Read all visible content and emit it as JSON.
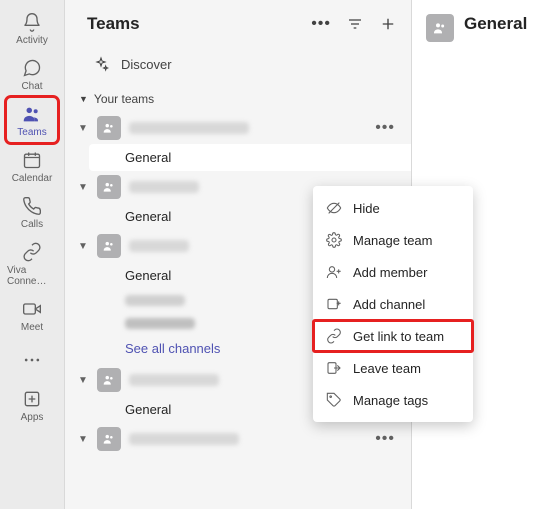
{
  "rail": {
    "items": [
      {
        "label": "Activity",
        "icon": "bell"
      },
      {
        "label": "Chat",
        "icon": "chat"
      },
      {
        "label": "Teams",
        "icon": "people",
        "selected": true
      },
      {
        "label": "Calendar",
        "icon": "calendar"
      },
      {
        "label": "Calls",
        "icon": "phone"
      },
      {
        "label": "Viva Conne…",
        "icon": "link"
      },
      {
        "label": "Meet",
        "icon": "video"
      },
      {
        "label": "",
        "icon": "more",
        "more": true
      },
      {
        "label": "Apps",
        "icon": "apps"
      }
    ]
  },
  "teams_panel": {
    "title": "Teams",
    "discover_label": "Discover",
    "section_label": "Your teams",
    "see_all_label": "See all channels",
    "general_label": "General"
  },
  "context_menu": {
    "items": [
      {
        "label": "Hide",
        "icon": "hide"
      },
      {
        "label": "Manage team",
        "icon": "gear"
      },
      {
        "label": "Add member",
        "icon": "add-member"
      },
      {
        "label": "Add channel",
        "icon": "add-channel"
      },
      {
        "label": "Get link to team",
        "icon": "link",
        "highlight": true
      },
      {
        "label": "Leave team",
        "icon": "leave"
      },
      {
        "label": "Manage tags",
        "icon": "tag"
      }
    ]
  },
  "right_panel": {
    "title": "General"
  }
}
